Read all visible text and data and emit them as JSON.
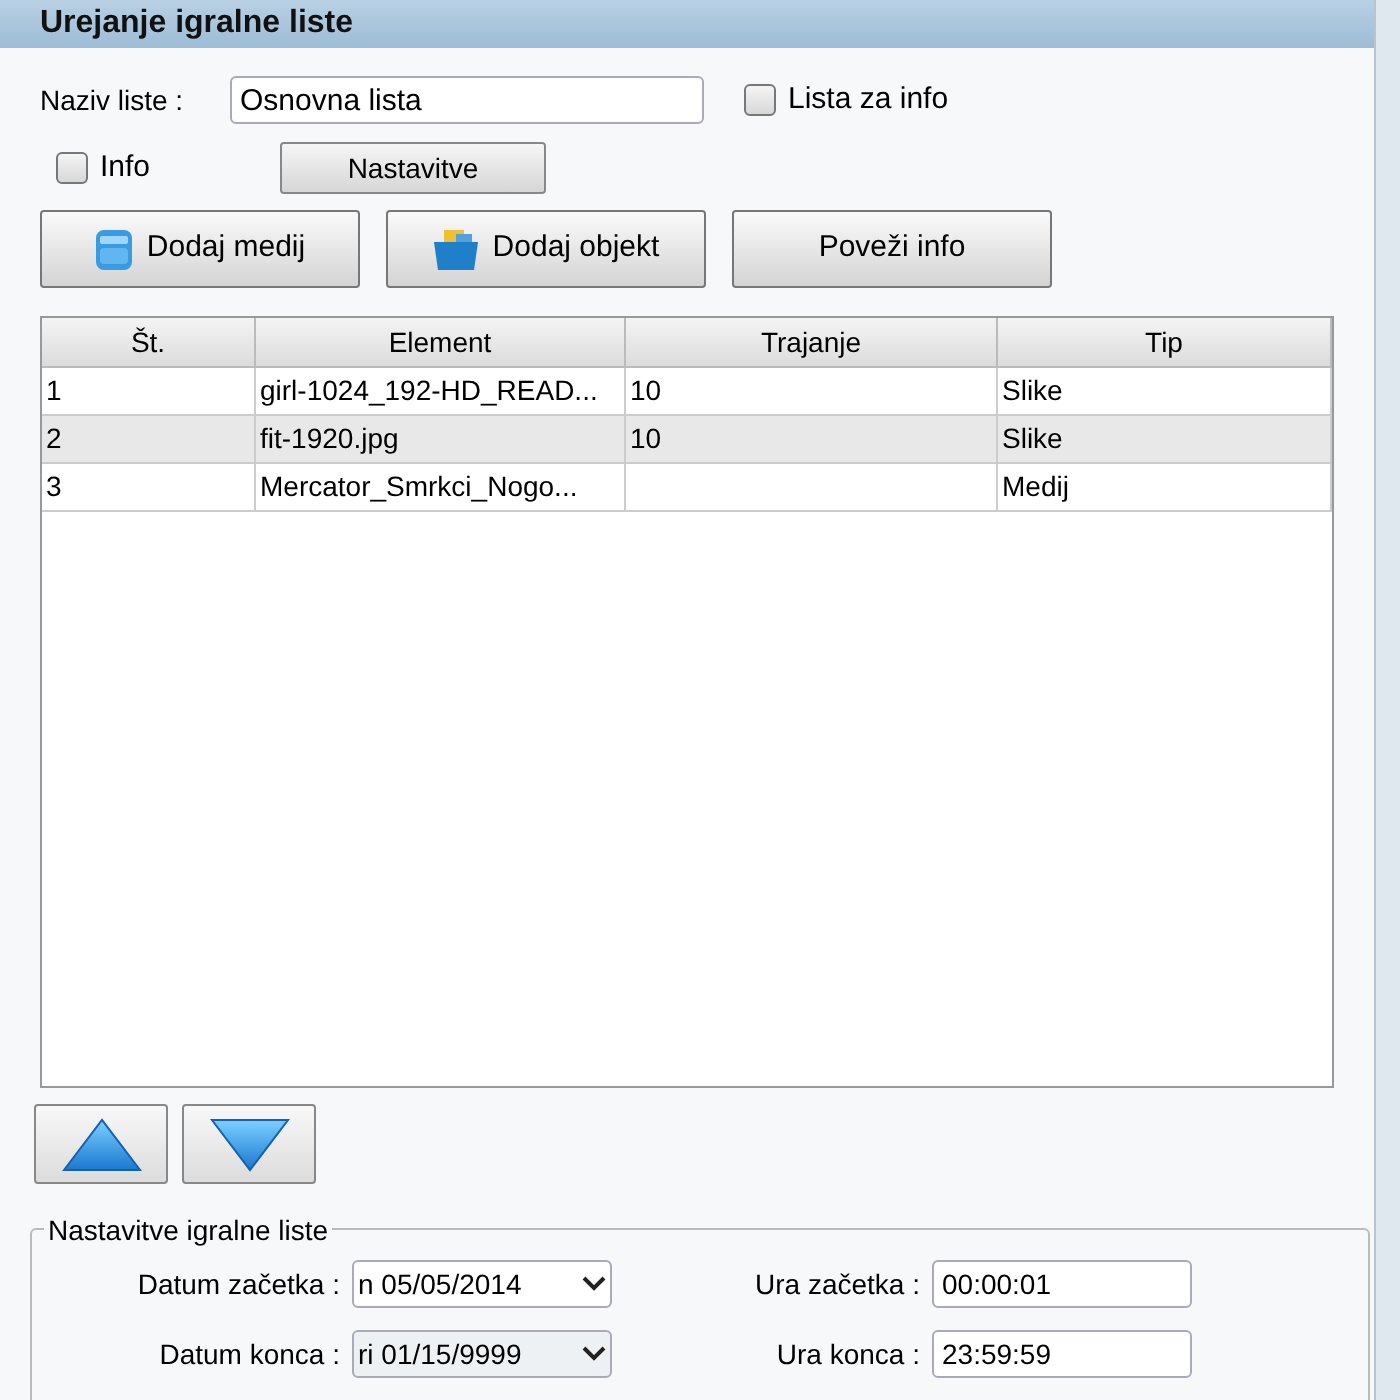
{
  "window": {
    "title": "Urejanje igralne liste"
  },
  "name_field": {
    "label": "Naziv liste :",
    "value": "Osnovna lista"
  },
  "list_for_info": {
    "label": "Lista za info",
    "checked": false
  },
  "info": {
    "label": "Info",
    "checked": false
  },
  "settings_button": "Nastavitve",
  "buttons": [
    {
      "label": "Dodaj medij",
      "kind": "media"
    },
    {
      "label": "Dodaj objekt",
      "kind": "object"
    },
    {
      "label": "Poveži info",
      "kind": "plain"
    }
  ],
  "table": {
    "columns": [
      "Št.",
      "Element",
      "Trajanje",
      "Tip"
    ],
    "rows": [
      [
        "1",
        "girl-1024_192-HD_READ...",
        "10",
        "Slike"
      ],
      [
        "2",
        "fit-1920.jpg",
        "10",
        "Slike"
      ],
      [
        "3",
        "Mercator_Smrkci_Nogo...",
        "",
        "Medij"
      ]
    ]
  },
  "move_buttons": [
    {
      "kind": "up"
    },
    {
      "kind": "down"
    }
  ],
  "settings_group": {
    "title": "Nastavitve igralne liste",
    "fields": [
      {
        "label": "Datum začetka :",
        "value": "n 05/05/2014",
        "kind": "date"
      },
      {
        "label": "Ura začetka :",
        "value": "00:00:01",
        "kind": "text"
      },
      {
        "label": "Datum konca :",
        "value": "ri 01/15/9999",
        "kind": "date"
      },
      {
        "label": "Ura konca :",
        "value": "23:59:59",
        "kind": "text"
      }
    ]
  }
}
